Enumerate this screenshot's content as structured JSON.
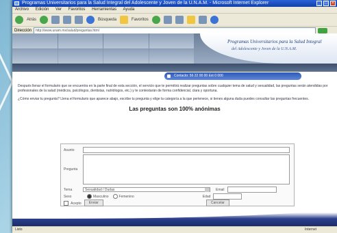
{
  "browser": {
    "title": "Programas Universitarios para la Salud Integral del Adolescente y Joven de la U.N.A.M. - Microsoft Internet Explorer",
    "menu": [
      "Archivo",
      "Edición",
      "Ver",
      "Favoritos",
      "Herramientas",
      "Ayuda"
    ],
    "toolbar": {
      "back_label": "Atrás",
      "search_label": "Búsqueda",
      "favorites_label": "Favoritos"
    },
    "address_label": "Dirección",
    "address_value": "http://www.unam.mx/salud/preguntas.html",
    "status_left": "Listo",
    "status_right": "Internet"
  },
  "site": {
    "banner_title": "Programas Universitarios para la Salud Integral",
    "banner_subtitle": "del Adolescente y Joven de la U.N.A.M.",
    "contact_text": "Contacto: 56 22 00 00      Ext 0 000"
  },
  "intro": {
    "p1": "Después llenar el formulario que se encuentra en la parte final de esta sección, el servicio que te permitirá realizar preguntas sobre cualquier tema de salud y sexualidad, las preguntas serán atendidas por profesionales de la salud (médicos, psicólogos, dentistas, nutriólogos, etc.) y te contestarán de forma confidencial, clara y oportuna.",
    "p2": "¿Cómo enviar tu pregunta? Llena el formulario que aparece abajo, escribe tu pregunta y elige la categoría a la que pertenece, si tienes alguna duda puedes consultar las preguntas frecuentes."
  },
  "form": {
    "title": "Las preguntas son 100% anónimas",
    "asunto_label": "Asunto",
    "pregunta_label": "Pregunta",
    "tema_label": "Tema",
    "tema_value": "Sexualidad / Dudas",
    "sexo_label": "Sexo",
    "sexo_opt1": "Masculino",
    "sexo_opt2": "Femenino",
    "edad_label": "Edad",
    "mail_label": "Email",
    "check_label": "Acepto",
    "submit_label": "Enviar",
    "reset_label": "Cancelar"
  }
}
